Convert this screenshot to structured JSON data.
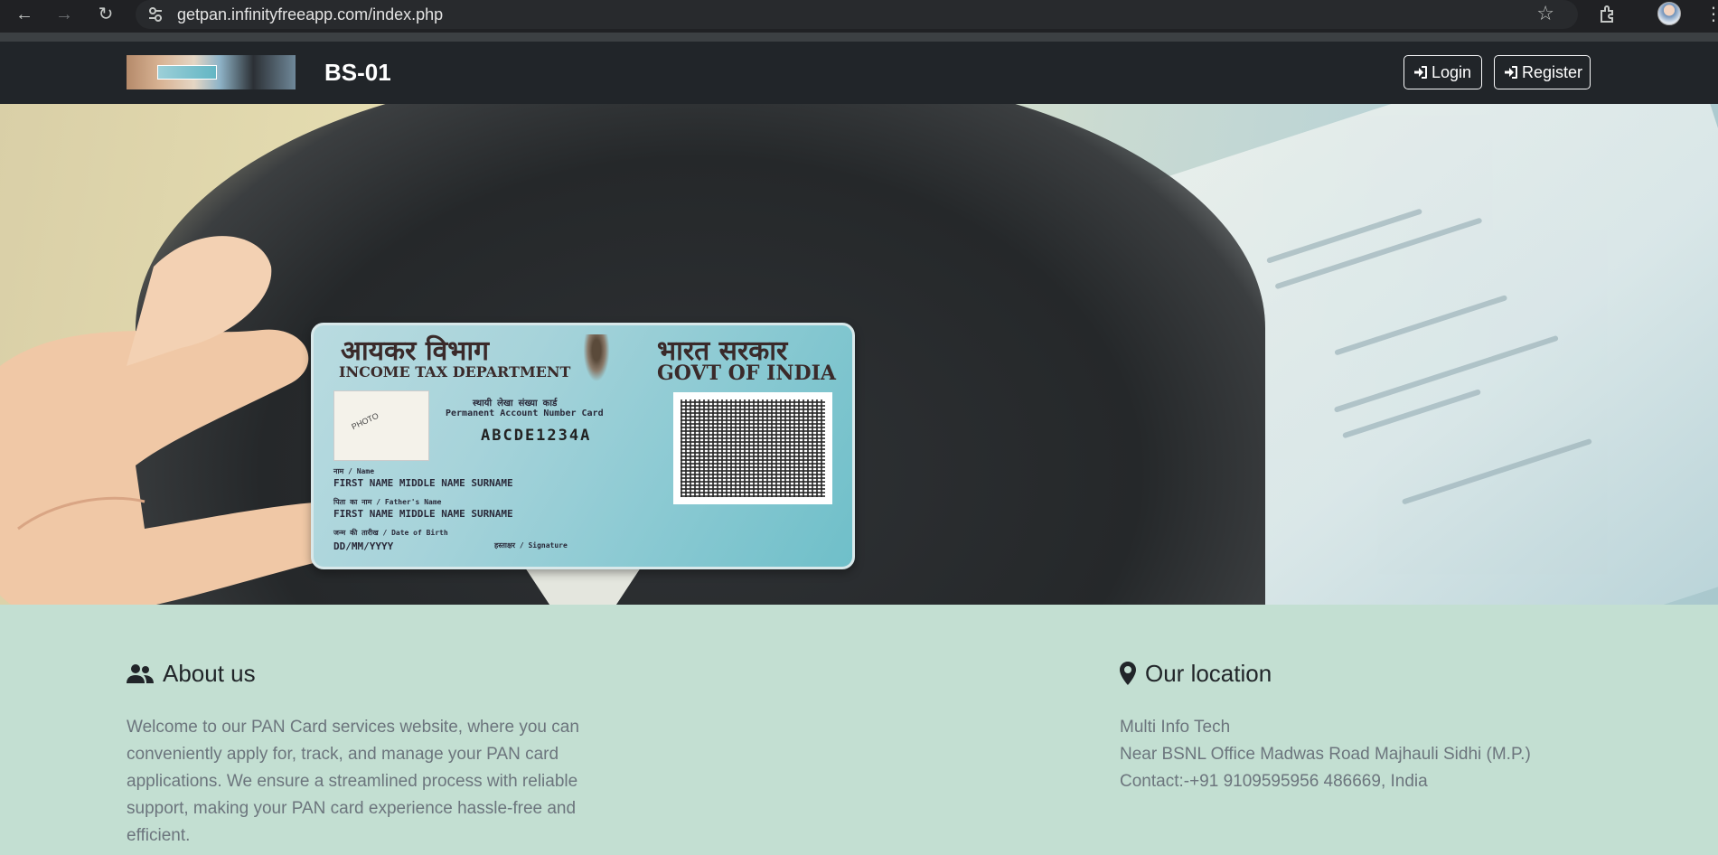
{
  "browser": {
    "url": "getpan.infinityfreeapp.com/index.php",
    "icons": [
      "back-icon",
      "forward-icon",
      "reload-icon",
      "site-info-icon",
      "star-icon",
      "extensions-icon",
      "profile-avatar",
      "menu-icon"
    ]
  },
  "navbar": {
    "brand": "BS-01",
    "login_label": "Login",
    "register_label": "Register",
    "bg_color": "#212529"
  },
  "hero": {
    "card": {
      "hindi_left": "आयकर विभाग",
      "hindi_right": "भारत सरकार",
      "dept": "INCOME TAX DEPARTMENT",
      "govt": "GOVT OF INDIA",
      "card_title_hi": "स्थायी लेखा संख्या कार्ड",
      "card_title_en": "Permanent Account Number Card",
      "pan_number": "ABCDE1234A",
      "name_label": "नाम / Name",
      "name_value": "FIRST NAME MIDDLE NAME SURNAME",
      "father_label": "पिता का नाम / Father's Name",
      "father_value": "FIRST NAME MIDDLE NAME SURNAME",
      "dob_label": "जन्म की तारीख / Date of Birth",
      "dob_value": "DD/MM/YYYY",
      "sign_label": "हस्ताक्षर / Signature"
    }
  },
  "about": {
    "title": "About us",
    "text": "Welcome to our PAN Card services website, where you can conveniently apply for, track, and manage your PAN card applications. We ensure a streamlined process with reliable support, making your PAN card experience hassle-free and efficient."
  },
  "location": {
    "title": "Our location",
    "name": "Multi Info Tech",
    "address": "Near BSNL Office Madwas Road Majhauli Sidhi (M.P.)",
    "contact": "Contact:-+91 9109595956 486669, India"
  },
  "colors": {
    "footer_bg": "#c3dfd2",
    "heading": "#212529",
    "body_text": "#6c757d"
  }
}
